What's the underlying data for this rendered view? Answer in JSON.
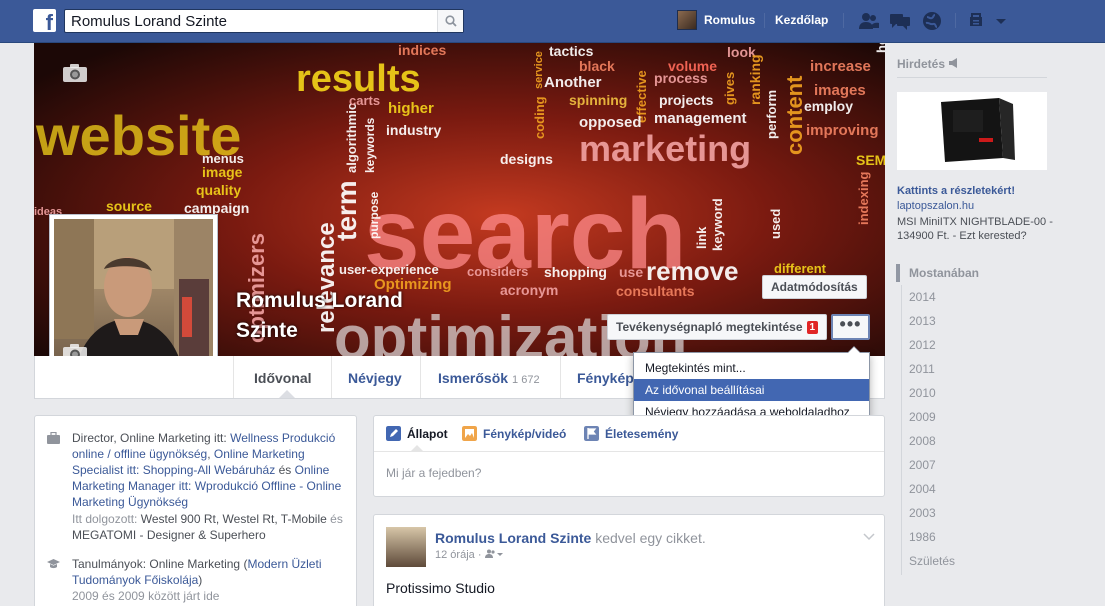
{
  "topbar": {
    "logo": "f",
    "search_value": "Romulus Lorand Szinte",
    "user_name": "Romulus",
    "home_label": "Kezdőlap"
  },
  "profile": {
    "name": "Romulus Lorand Szinte",
    "edit_button": "Adatmódosítás",
    "activity_button": "Tevékenységnapló megtekintése",
    "activity_badge": "1",
    "more_button": "•••"
  },
  "cover_words": [
    "website",
    "results",
    "search",
    "marketing",
    "optimization",
    "Another",
    "spinning",
    "projects",
    "management",
    "increase",
    "images",
    "employ",
    "improving",
    "volume",
    "process",
    "tactics",
    "black",
    "look",
    "content",
    "perform",
    "coding",
    "service",
    "effective",
    "gives",
    "ranking",
    "help",
    "industry",
    "opposed",
    "designs",
    "menus",
    "image",
    "quality",
    "source",
    "campaign",
    "term",
    "algorithmic",
    "keywords",
    "user-experience",
    "considers",
    "shopping",
    "use",
    "remove",
    "different",
    "consultants",
    "acronym",
    "indexing",
    "link",
    "keyword",
    "used",
    "relevance",
    "purpose",
    "indices",
    "higher",
    "carts",
    "SEM",
    "ideas",
    "optimizers",
    "Optimizing"
  ],
  "tabs": {
    "timeline": "Idővonal",
    "about": "Névjegy",
    "friends": "Ismerősök",
    "friends_count": "1 672",
    "photos": "Fényképek"
  },
  "menu": {
    "items": [
      "Megtekintés mint...",
      "Az idővonal beállításai",
      "Névjegy hozzáadása a weboldaladhoz"
    ],
    "active_index": 1
  },
  "intro": {
    "work_prefix": "Director, Online Marketing itt:",
    "work_1": "Wellness Produkció online / offline ügynökség",
    "comma": ",",
    "work_2": "Online Marketing Specialist itt:",
    "work_3": "Shopping-All Webáruház",
    "and": "és",
    "work_4": "Online Marketing Manager itt:",
    "work_5": "Wprodukció Offline - Online Marketing Ügynökség",
    "worked_at": "Itt dolgozott:",
    "worked_list": "Westel 900 Rt, Westel Rt, T-Mobile",
    "worked_and": "és",
    "worked_last": "MEGATOMI - Designer & Superhero",
    "study_prefix": "Tanulmányok:",
    "study_1": "Online Marketing",
    "study_2": "Modern Üzleti Tudományok Főiskolája",
    "study_years": "2009 és 2009 között járt ide"
  },
  "composer": {
    "status": "Állapot",
    "photo": "Fénykép/videó",
    "life_event": "Életesemény",
    "placeholder": "Mi jár a fejedben?"
  },
  "post": {
    "author": "Romulus Lorand Szinte",
    "action": "kedvel egy cikket.",
    "time": "12 órája",
    "text": "Protissimo Studio"
  },
  "ad": {
    "header": "Hirdetés",
    "title": "Kattints a részletekért!",
    "url": "laptopszalon.hu",
    "desc": "MSI MiniITX NIGHTBLADE-00 - 134900 Ft. - Ezt kerested?"
  },
  "years": [
    "Mostanában",
    "2014",
    "2013",
    "2012",
    "2011",
    "2010",
    "2009",
    "2008",
    "2007",
    "2004",
    "2003",
    "1986",
    "Születés"
  ],
  "colors": {
    "brand": "#3b5998",
    "menu_active": "#4267b2",
    "badge": "#e02525"
  }
}
